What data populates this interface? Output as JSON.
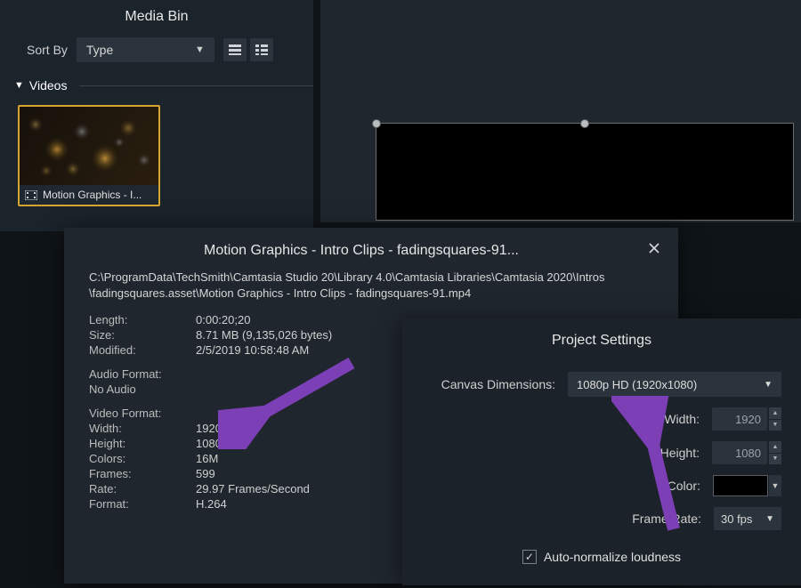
{
  "media_bin": {
    "title": "Media Bin",
    "sort_label": "Sort By",
    "sort_value": "Type",
    "section": "Videos",
    "thumb_caption": "Motion Graphics - I..."
  },
  "info": {
    "title": "Motion Graphics - Intro Clips - fadingsquares-91...",
    "path_line1": "C:\\ProgramData\\TechSmith\\Camtasia Studio 20\\Library 4.0\\Camtasia Libraries\\Camtasia 2020\\Intros",
    "path_line2": "\\fadingsquares.asset\\Motion Graphics - Intro Clips - fadingsquares-91.mp4",
    "length_k": "Length:",
    "length_v": "0:00:20;20",
    "size_k": "Size:",
    "size_v": "8.71 MB (9,135,026 bytes)",
    "modified_k": "Modified:",
    "modified_v": "2/5/2019 10:58:48 AM",
    "audio_k": "Audio Format:",
    "audio_v": "No Audio",
    "video_k": "Video Format:",
    "width_k": "Width:",
    "width_v": "1920",
    "height_k": "Height:",
    "height_v": "1080",
    "colors_k": "Colors:",
    "colors_v": "16M",
    "frames_k": "Frames:",
    "frames_v": "599",
    "rate_k": "Rate:",
    "rate_v": "29.97 Frames/Second",
    "format_k": "Format:",
    "format_v": "H.264"
  },
  "project": {
    "title": "Project Settings",
    "canvas_label": "Canvas Dimensions:",
    "canvas_value": "1080p HD (1920x1080)",
    "width_label": "Width:",
    "width_value": "1920",
    "height_label": "Height:",
    "height_value": "1080",
    "color_label": "Color:",
    "rate_label": "Frame Rate:",
    "rate_value": "30 fps",
    "auto_label": "Auto-normalize loudness"
  }
}
